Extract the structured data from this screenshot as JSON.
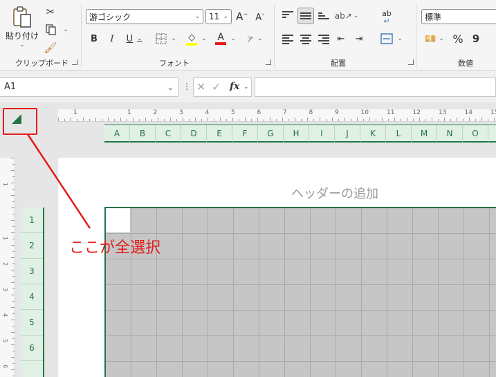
{
  "ribbon": {
    "clipboard": {
      "paste_label": "貼り付け",
      "group_label": "クリップボード"
    },
    "font": {
      "font_name": "游ゴシック",
      "font_size": "11",
      "group_label": "フォント",
      "bold": "B",
      "italic": "I",
      "underline": "U",
      "font_color_glyph": "A",
      "grow_glyph": "A",
      "shrink_glyph": "A",
      "phonetic_glyph": "ア"
    },
    "alignment": {
      "group_label": "配置",
      "wrap_glyph": "ab"
    },
    "number": {
      "format": "標準",
      "group_label": "数値",
      "percent": "%",
      "comma": "9"
    }
  },
  "formula_bar": {
    "name_box": "A1",
    "fx": "fx"
  },
  "sheet": {
    "columns": [
      "A",
      "B",
      "C",
      "D",
      "E",
      "F",
      "G",
      "H",
      "I",
      "J",
      "K",
      "L",
      "M",
      "N",
      "O"
    ],
    "rows": [
      "1",
      "2",
      "3",
      "4",
      "5",
      "6"
    ],
    "ruler_numbers": [
      "1",
      "1",
      "2",
      "3",
      "4",
      "5",
      "6",
      "7",
      "8",
      "9",
      "10",
      "11",
      "12",
      "13",
      "14",
      "15"
    ],
    "vruler_numbers": [
      "1",
      "1",
      "2",
      "3",
      "4",
      "5",
      "6"
    ],
    "header_placeholder": "ヘッダーの追加",
    "accent": "#217346"
  },
  "annotation": {
    "text": "ここが全選択",
    "color": "#e31b1b"
  }
}
